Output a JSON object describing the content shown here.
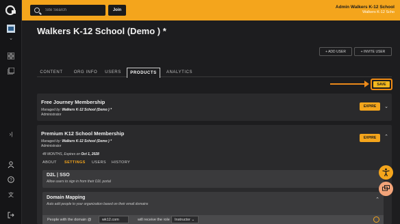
{
  "topbar": {
    "search_placeholder": "Site Search",
    "join_label": "Join",
    "account_name": "Admin Walkers K-12 School",
    "account_org": "Walkers K-12 Scho"
  },
  "page": {
    "title": "Walkers K-12 School (Demo ) *",
    "add_user_label": "+ ADD USER",
    "invite_user_label": "+ INVITE USER"
  },
  "tabs": [
    "CONTENT",
    "ORG INFO",
    "USERS",
    "PRODUCTS",
    "ANALYTICS"
  ],
  "save_label": "SAVE",
  "cards": [
    {
      "title": "Free Journey Membership",
      "managed_prefix": "Managed by:",
      "managed_by": "Walkers K-12 School (Demo ) *",
      "role": "Administrator",
      "action": "EXPIRE"
    },
    {
      "title": "Premium K12 School Membership",
      "managed_prefix": "Managed by:",
      "managed_by": "Walkers K-12 School (Demo ) *",
      "role": "Administrator",
      "action": "EXPIRE",
      "duration": "48 MONTHS,",
      "expires": "Expires on",
      "expires_date": "Oct 1, 2028",
      "subtabs": [
        "ABOUT",
        "SETTINGS",
        "USERS",
        "HISTORY"
      ]
    }
  ],
  "sections": [
    {
      "title": "D2L | SSO",
      "description": "Allow users to sign in from their D2L portal"
    },
    {
      "title": "Domain Mapping",
      "description": "Auto add people to your organization based on their email domains"
    }
  ],
  "domain_row": {
    "prefix": "People with the domain @",
    "domain_value": "wk12.com",
    "middle": "will receive the role",
    "role_value": "Instructor"
  },
  "colors": {
    "accent": "#f4a51c",
    "highlight": "#f28c13",
    "background": "#1d1d1f",
    "fab_accessibility": "#f4a51c",
    "fab_chat": "#f3a47a"
  }
}
